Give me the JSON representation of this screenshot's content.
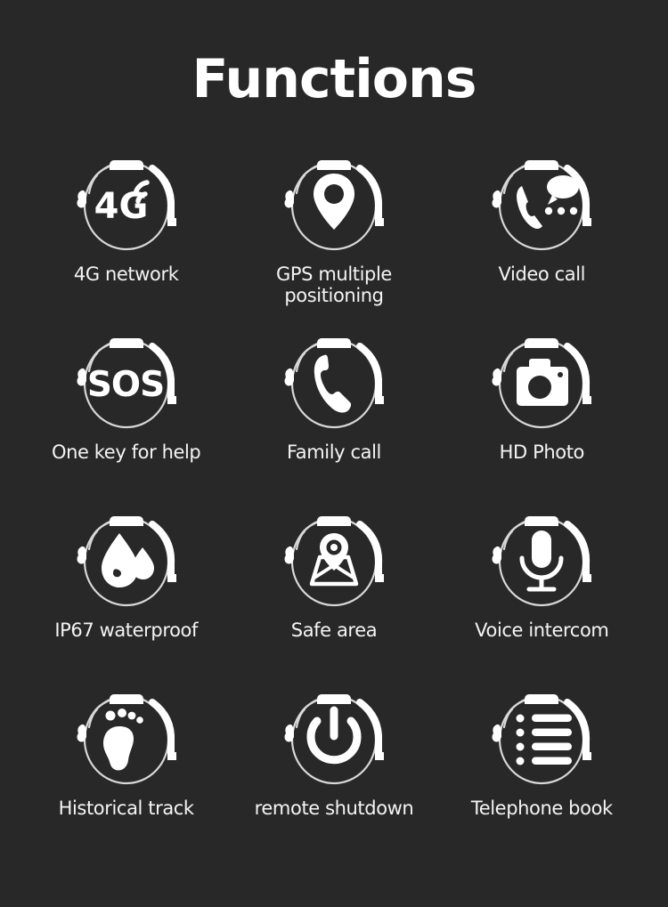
{
  "page": {
    "background_color": "#282828",
    "text_color": "#f4f4f4",
    "accent_color": "#ffffff"
  },
  "header": {
    "title": "Functions"
  },
  "grid": {
    "columns": 3,
    "rows": 4,
    "items": [
      {
        "icon": "4g-signal-icon",
        "label": "4G network",
        "glyph_text": "4G"
      },
      {
        "icon": "map-pin-icon",
        "label": "GPS multiple\npositioning",
        "glyph_text": ""
      },
      {
        "icon": "video-call-icon",
        "label": "Video call",
        "glyph_text": ""
      },
      {
        "icon": "sos-icon",
        "label": "One key for help",
        "glyph_text": "SOS"
      },
      {
        "icon": "phone-handset-icon",
        "label": "Family call",
        "glyph_text": ""
      },
      {
        "icon": "camera-icon",
        "label": "HD Photo",
        "glyph_text": ""
      },
      {
        "icon": "water-drop-icon",
        "label": "IP67 waterproof",
        "glyph_text": ""
      },
      {
        "icon": "map-area-pin-icon",
        "label": "Safe area",
        "glyph_text": ""
      },
      {
        "icon": "microphone-icon",
        "label": "Voice intercom",
        "glyph_text": ""
      },
      {
        "icon": "footprint-icon",
        "label": "Historical track",
        "glyph_text": ""
      },
      {
        "icon": "power-icon",
        "label": "remote shutdown",
        "glyph_text": ""
      },
      {
        "icon": "contact-list-icon",
        "label": "Telephone book",
        "glyph_text": ""
      }
    ]
  }
}
